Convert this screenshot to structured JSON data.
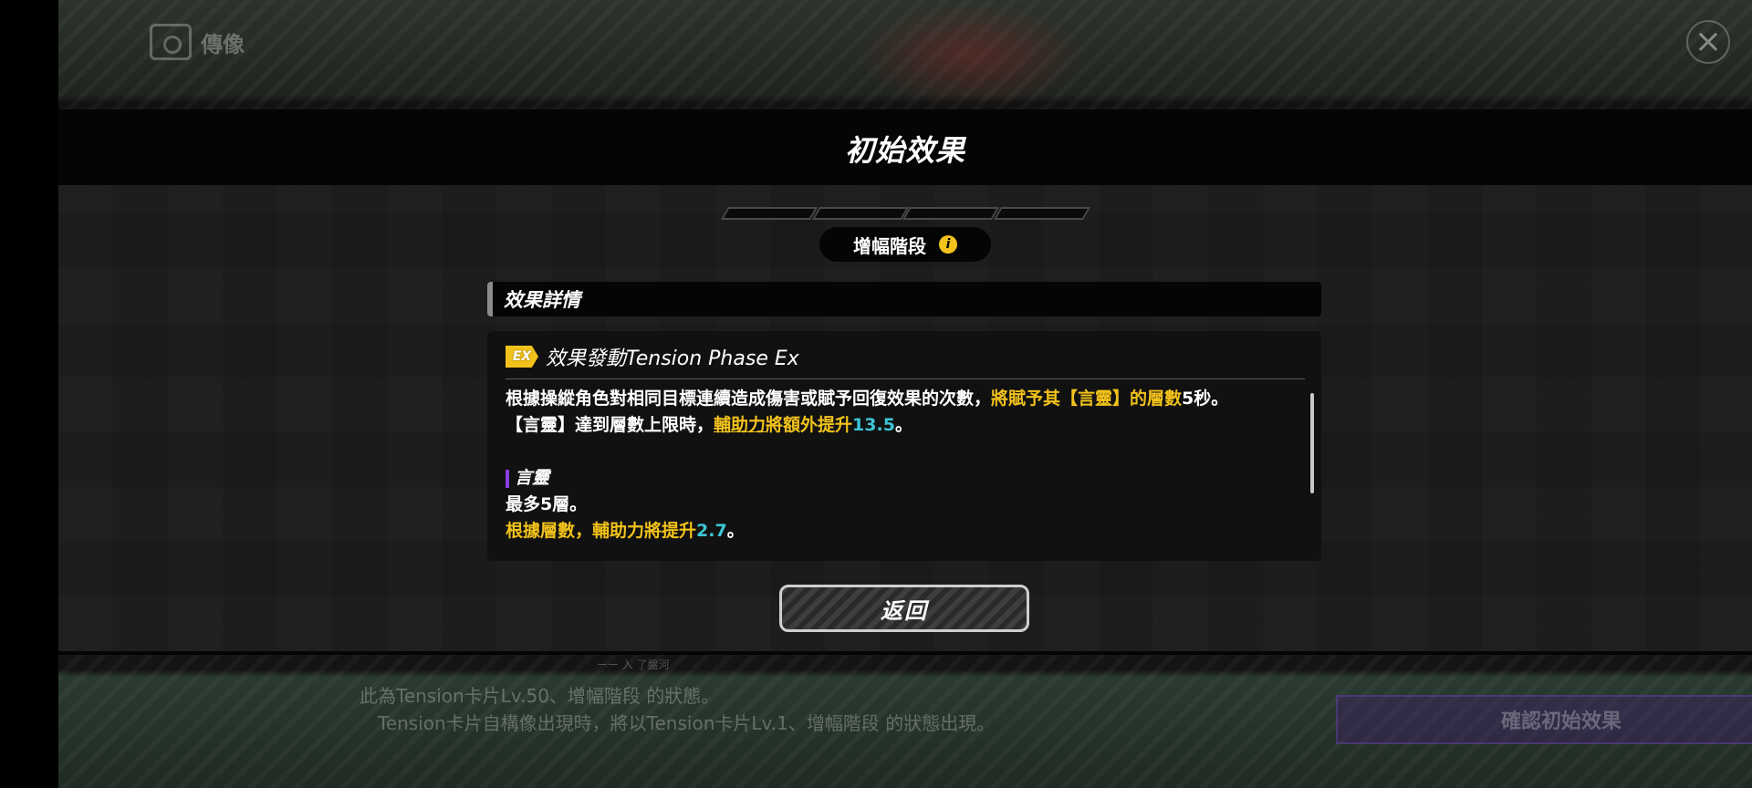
{
  "background": {
    "top_title": "傳像",
    "note_line1": "此為Tension卡片Lv.50、增幅階段 的狀態。",
    "note_line2": "Tension卡片自構像出現時，將以Tension卡片Lv.1、增幅階段 的狀態出現。",
    "confirm_label": "確認初始效果",
    "small_text": "ーー 入 了盤河"
  },
  "modal": {
    "title": "初始效果",
    "phase_label": "增幅階段",
    "details_label": "效果詳情",
    "effect": {
      "badge": "EX",
      "name": "效果發動Tension Phase Ex",
      "line1_a": "根據操縱角色對相同目標連續造成傷害或賦予回復效果的次數，",
      "line1_b": "將賦予其【言靈】的層數",
      "line1_c": "5秒。",
      "line2_a": "【言靈】達到層數上限時，",
      "line2_b": "輔助力",
      "line2_c": "將額外提升",
      "line2_num": "13.5",
      "line2_d": "。",
      "sub_title": "言靈",
      "sub_line1": "最多5層。",
      "sub_line2_a": "根據層數，輔助力將提升",
      "sub_line2_num": "2.7",
      "sub_line2_b": "。"
    },
    "return_label": "返回"
  },
  "colors": {
    "highlight": "#f2c21b",
    "number": "#3ec6d6",
    "accent_purple": "#8a3de0"
  },
  "icons": [
    "portrait-icon",
    "close-icon",
    "info-icon",
    "ex-badge-icon"
  ]
}
